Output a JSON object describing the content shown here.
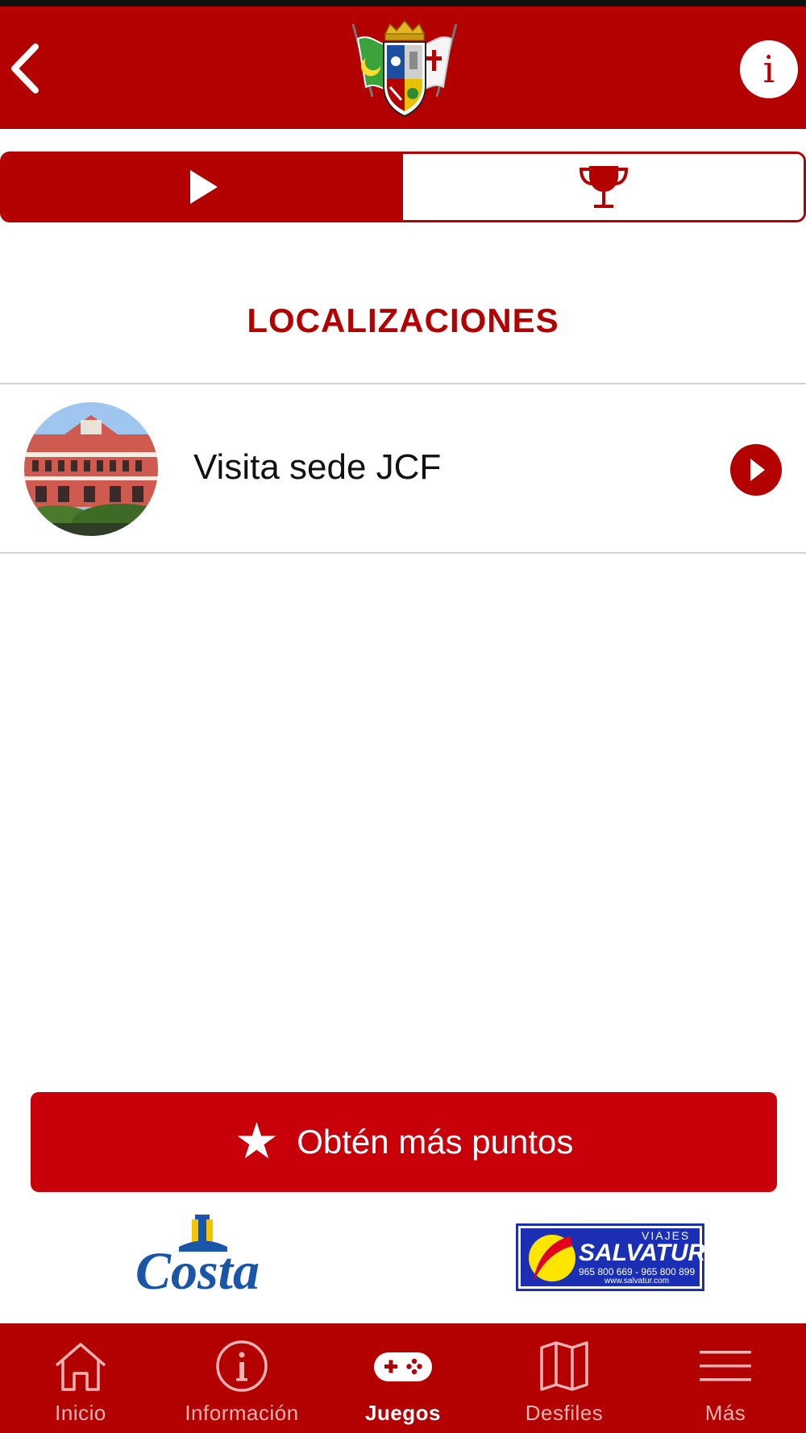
{
  "header": {
    "back_icon": "chevron-left-icon",
    "logo": "coat-of-arms-logo",
    "info_icon": "info-icon",
    "info_glyph": "i"
  },
  "segments": [
    {
      "icon": "play-icon",
      "selected": true
    },
    {
      "icon": "trophy-icon",
      "selected": false
    }
  ],
  "section_title": "LOCALIZACIONES",
  "locations": [
    {
      "label": "Visita sede JCF",
      "thumbnail": "building-photo",
      "action_icon": "chevron-right-circle-icon"
    }
  ],
  "cta": {
    "icon": "star-icon",
    "star_glyph": "★",
    "label": "Obtén más puntos"
  },
  "sponsors": {
    "costa": {
      "name": "Costa"
    },
    "salvatur": {
      "top": "VIAJES",
      "name": "SALVATUR",
      "phones": "965 800 669 - 965 800 899",
      "web": "www.salvatur.com"
    }
  },
  "tabbar": [
    {
      "label": "Inicio",
      "icon": "home-icon",
      "active": false
    },
    {
      "label": "Información",
      "icon": "info-circle-icon",
      "active": false
    },
    {
      "label": "Juegos",
      "icon": "gamepad-icon",
      "active": true
    },
    {
      "label": "Desfiles",
      "icon": "map-icon",
      "active": false
    },
    {
      "label": "Más",
      "icon": "menu-icon",
      "active": false
    }
  ],
  "colors": {
    "primary": "#b30000",
    "cta": "#c8000a",
    "divider": "#d2d2d2",
    "text": "#111111",
    "tab_inactive": "#f1b3b3"
  }
}
